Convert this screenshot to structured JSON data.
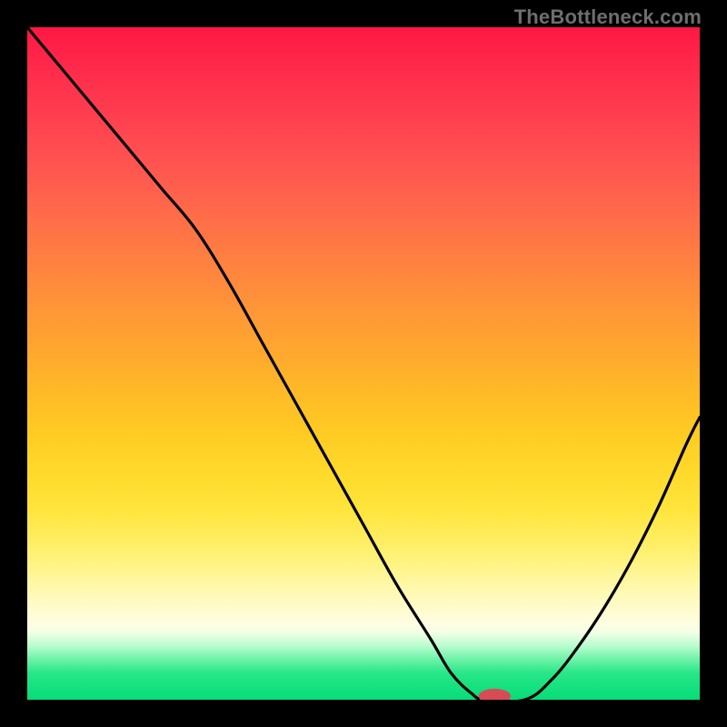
{
  "watermark": "TheBottleneck.com",
  "colors": {
    "background": "#000000",
    "curve": "#000000",
    "marker": "#d94a57"
  },
  "chart_data": {
    "type": "line",
    "title": "",
    "xlabel": "",
    "ylabel": "",
    "xlim": [
      0,
      100
    ],
    "ylim": [
      0,
      100
    ],
    "grid": false,
    "legend": false,
    "series": [
      {
        "name": "curve",
        "x": [
          0,
          5,
          10,
          15,
          20,
          25,
          30,
          35,
          40,
          45,
          50,
          55,
          60,
          63,
          66,
          68,
          74,
          78,
          82,
          86,
          90,
          94,
          98,
          100
        ],
        "y": [
          100,
          94,
          88,
          82,
          76,
          70,
          62,
          53,
          44,
          35,
          26,
          17,
          9,
          4,
          1,
          0,
          0,
          3,
          8,
          14,
          21,
          29,
          38,
          42
        ]
      }
    ],
    "marker": {
      "x": 69.5,
      "y": 0,
      "rx": 2.4,
      "ry": 1.1
    }
  }
}
